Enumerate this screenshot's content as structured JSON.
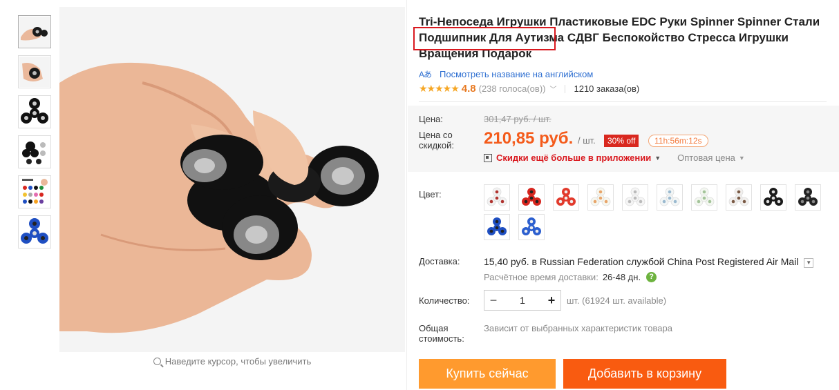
{
  "product": {
    "title": "Tri-Непоседа Игрушки Пластиковые EDC Руки Spinner Spinner Стали Подшипник Для Аутизма СДВГ Беспокойство Стресса Игрушки Вращения Подарок",
    "translate_link": "Посмотреть название на английском",
    "translate_icon": "translate-icon",
    "rating": "4.8",
    "votes": "(238 голоса(ов))",
    "orders": "1210 заказа(ов)"
  },
  "gallery": {
    "zoom_hint": "Наведите курсор, чтобы увеличить",
    "thumbnails": [
      "hand-spinner-1",
      "hand-spinner-2",
      "black-spinner",
      "spinner-set",
      "spinner-chart",
      "blue-spinner"
    ]
  },
  "price": {
    "label_price": "Цена:",
    "old_price": "301,47 руб. / шт.",
    "label_discount": "Цена со скидкой:",
    "new_price": "210,85 руб.",
    "unit": "/ шт.",
    "discount_badge": "30% off",
    "timer": "11h:56m:12s",
    "app_discount": "Скидки ещё больше в приложении",
    "wholesale": "Оптовая цена"
  },
  "color": {
    "label": "Цвет:",
    "options": [
      {
        "name": "white-red",
        "body": "#f2f2f2",
        "ring": "#b0332f"
      },
      {
        "name": "red",
        "body": "#d7261f",
        "ring": "#222"
      },
      {
        "name": "red-white",
        "body": "#e23a2c",
        "ring": "#eee"
      },
      {
        "name": "glow-orange",
        "body": "#f7f7ef",
        "ring": "#e8a56b"
      },
      {
        "name": "glow-white",
        "body": "#f5f5f5",
        "ring": "#bbbbbb"
      },
      {
        "name": "glow-blue",
        "body": "#f3f6f6",
        "ring": "#9bbad0"
      },
      {
        "name": "glow-green",
        "body": "#f3f7f0",
        "ring": "#a4c49a"
      },
      {
        "name": "white-brown",
        "body": "#f2f0ee",
        "ring": "#7a5a45"
      },
      {
        "name": "black",
        "body": "#1a1a1a",
        "ring": "#ddd"
      },
      {
        "name": "black-gray",
        "body": "#222",
        "ring": "#888"
      },
      {
        "name": "blue",
        "body": "#1f4fc2",
        "ring": "#222"
      },
      {
        "name": "blue-white",
        "body": "#2c5fcf",
        "ring": "#eee"
      }
    ]
  },
  "shipping": {
    "label": "Доставка:",
    "cost": "15,40 руб.",
    "text": "в Russian Federation службой China Post Registered Air Mail",
    "eta_label": "Расчётное время доставки:",
    "eta_days": "26-48 дн."
  },
  "quantity": {
    "label": "Количество:",
    "value": "1",
    "available": "шт. (61924 шт. available)"
  },
  "total": {
    "label": "Общая стоимость:",
    "note": "Зависит от выбранных характеристик товара"
  },
  "actions": {
    "buy_now": "Купить сейчас",
    "add_to_cart": "Добавить в корзину"
  },
  "colors": {
    "accent_orange": "#f45b1b",
    "buy_button": "#ff9a2e",
    "cart_button": "#f95b10",
    "highlight": "#d9181e",
    "link": "#2e6fd1"
  }
}
